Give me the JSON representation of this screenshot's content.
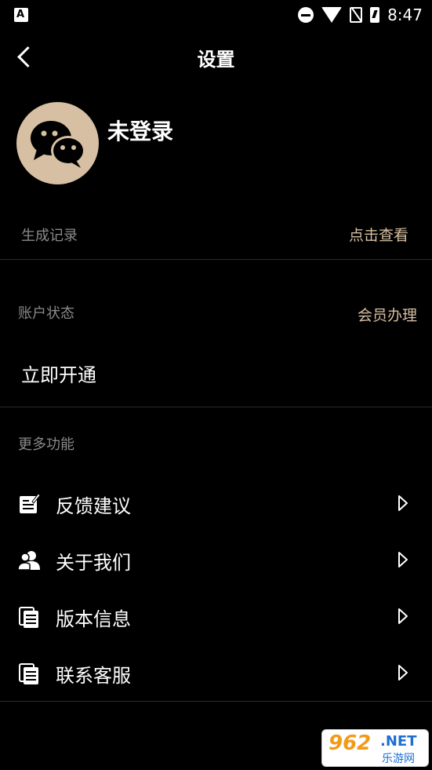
{
  "status_bar": {
    "app_icon_letter": "A",
    "time": "8:47"
  },
  "header": {
    "title": "设置"
  },
  "profile": {
    "name": "未登录"
  },
  "records": {
    "label": "生成记录",
    "link": "点击查看"
  },
  "account": {
    "label": "账户状态",
    "link": "会员办理",
    "action": "立即开通"
  },
  "more": {
    "label": "更多功能",
    "items": [
      {
        "label": "反馈建议",
        "icon": "feedback-icon"
      },
      {
        "label": "关于我们",
        "icon": "users-icon"
      },
      {
        "label": "版本信息",
        "icon": "document-icon"
      },
      {
        "label": "联系客服",
        "icon": "document-icon"
      }
    ]
  },
  "colors": {
    "background": "#000000",
    "accent": "#d6bfa2",
    "muted_text": "#8a8a8a"
  },
  "watermark": {
    "number": "962",
    "net": ".NET",
    "sub": "乐游网"
  }
}
